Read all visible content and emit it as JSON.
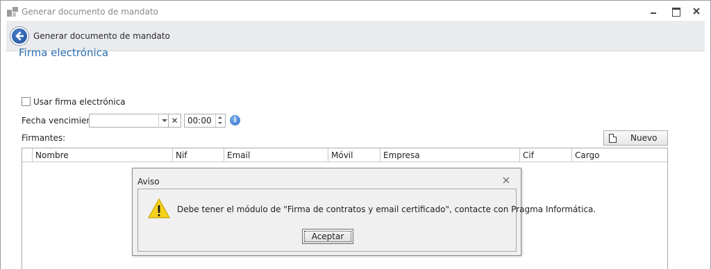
{
  "window": {
    "title": "Generar documento de mandato"
  },
  "header": {
    "title": "Generar documento de mandato"
  },
  "section": {
    "title": "Firma electrónica"
  },
  "form": {
    "use_signature_label": "Usar firma electrónica",
    "use_signature_checked": false,
    "expiry_label": "Fecha vencimiento:",
    "expiry_date_value": "",
    "expiry_time_value": "00:00",
    "signers_label": "Firmantes:",
    "new_button_label": "Nuevo"
  },
  "grid": {
    "columns": [
      "Nombre",
      "Nif",
      "Email",
      "Móvil",
      "Empresa",
      "Cif",
      "Cargo"
    ],
    "rows": []
  },
  "dialog": {
    "title": "Aviso",
    "message": "Debe tener el módulo de \"Firma de contratos y email certificado\", contacte con Pragma Informática.",
    "accept_label": "Aceptar"
  },
  "colors": {
    "section_title": "#2b6cb0",
    "header_band": "#e9ebee",
    "warning_fill": "#f7d21c"
  },
  "icons": [
    "app-icon",
    "minimize-icon",
    "maximize-icon",
    "close-icon",
    "back-arrow-icon",
    "dropdown-icon",
    "clear-icon",
    "spin-up-icon",
    "spin-down-icon",
    "info-icon",
    "document-icon",
    "dialog-close-icon",
    "warning-icon"
  ]
}
